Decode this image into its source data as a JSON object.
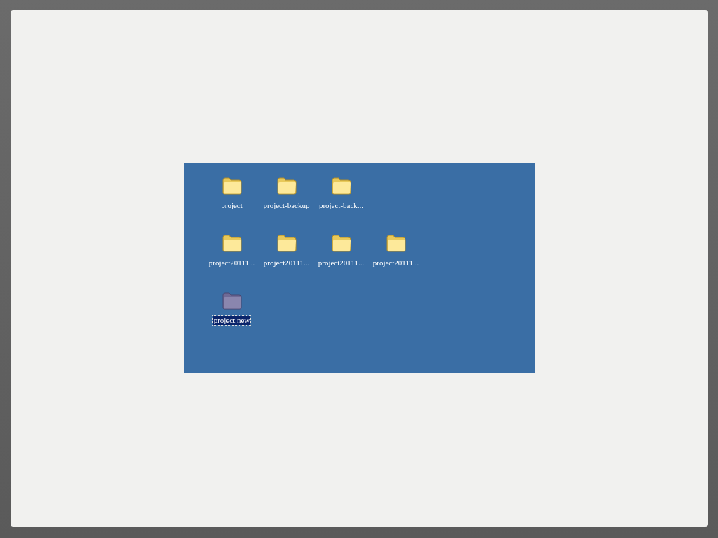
{
  "desktop": {
    "rows": [
      {
        "icons": [
          {
            "label": "project",
            "selected": false
          },
          {
            "label": "project-backup",
            "selected": false
          },
          {
            "label": "project-back...",
            "selected": false
          }
        ]
      },
      {
        "icons": [
          {
            "label": "project20111...",
            "selected": false
          },
          {
            "label": "project20111...",
            "selected": false
          },
          {
            "label": "project20111...",
            "selected": false
          },
          {
            "label": "project20111...",
            "selected": false
          }
        ]
      },
      {
        "icons": [
          {
            "label": "project new",
            "selected": true
          }
        ]
      }
    ]
  }
}
